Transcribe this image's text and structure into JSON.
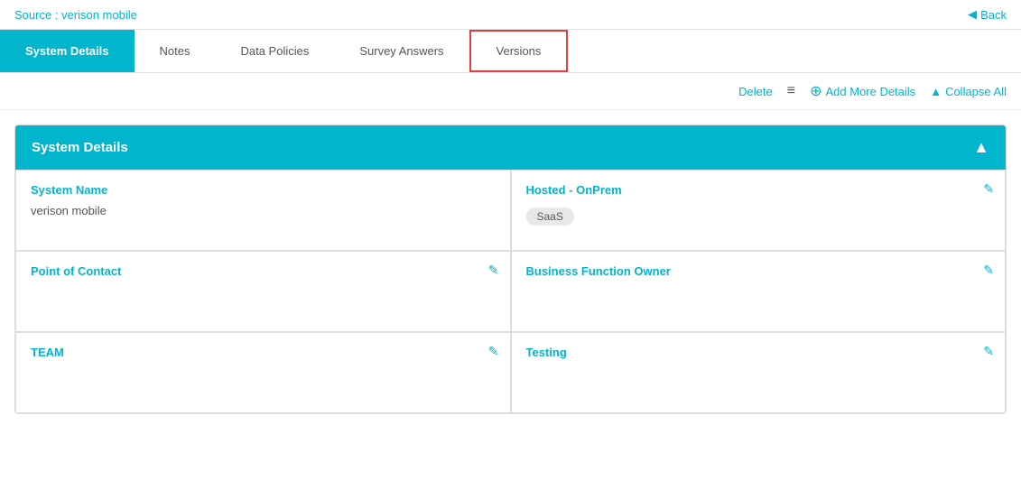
{
  "topBar": {
    "source_label": "Source : verison mobile",
    "back_label": "Back"
  },
  "tabs": [
    {
      "id": "system-details",
      "label": "System Details",
      "active": true,
      "highlighted": false
    },
    {
      "id": "notes",
      "label": "Notes",
      "active": false,
      "highlighted": false
    },
    {
      "id": "data-policies",
      "label": "Data Policies",
      "active": false,
      "highlighted": false
    },
    {
      "id": "survey-answers",
      "label": "Survey Answers",
      "active": false,
      "highlighted": false
    },
    {
      "id": "versions",
      "label": "Versions",
      "active": false,
      "highlighted": true
    }
  ],
  "toolbar": {
    "delete_label": "Delete",
    "add_more_label": "Add More Details",
    "collapse_label": "Collapse All"
  },
  "section": {
    "title": "System Details"
  },
  "cards": [
    {
      "id": "system-name",
      "title": "System Name",
      "value": "verison mobile",
      "editable": false,
      "badge": null
    },
    {
      "id": "hosted-onprem",
      "title": "Hosted - OnPrem",
      "value": "",
      "editable": true,
      "badge": "SaaS"
    },
    {
      "id": "point-of-contact",
      "title": "Point of Contact",
      "value": "",
      "editable": true,
      "badge": null
    },
    {
      "id": "business-function-owner",
      "title": "Business Function Owner",
      "value": "",
      "editable": true,
      "badge": null
    },
    {
      "id": "team",
      "title": "TEAM",
      "value": "",
      "editable": true,
      "badge": null
    },
    {
      "id": "testing",
      "title": "Testing",
      "value": "",
      "editable": true,
      "badge": null
    }
  ],
  "icons": {
    "back": "◀",
    "chevron_up": "▲",
    "edit": "✎",
    "add": "+",
    "menu": "≡",
    "globe": "🌐"
  },
  "colors": {
    "primary": "#00b5cc",
    "highlight_border": "#e53e3e"
  }
}
